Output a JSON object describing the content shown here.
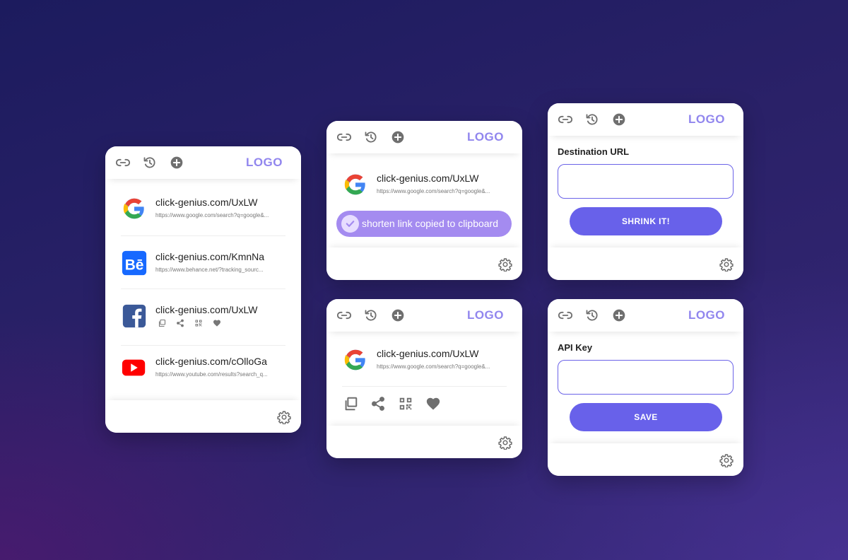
{
  "brand": {
    "logo_text": "LOGO",
    "logo_color": "#9186ee",
    "accent": "#6861ea",
    "icon_gray": "#6f6f6f"
  },
  "history_card": {
    "links": [
      {
        "icon": "google-logo-icon",
        "short": "click-genius.com/UxLW",
        "long": "https://www.google.com/search?q=google&..."
      },
      {
        "icon": "behance-logo-icon",
        "short": "click-genius.com/KmnNa",
        "long": "https://www.behance.net/?tracking_sourc..."
      },
      {
        "icon": "facebook-logo-icon",
        "short": "click-genius.com/UxLW",
        "long": ""
      },
      {
        "icon": "youtube-logo-icon",
        "short": "click-genius.com/cOlloGa",
        "long": "https://www.youtube.com/results?search_q..."
      }
    ]
  },
  "copied_card": {
    "link": {
      "short": "click-genius.com/UxLW",
      "long": "https://www.google.com/search?q=google&..."
    },
    "toast": "shorten link copied to clipboard"
  },
  "actions_card": {
    "link": {
      "short": "click-genius.com/UxLW",
      "long": "https://www.google.com/search?q=google&..."
    },
    "actions": [
      "copy-icon",
      "share-icon",
      "qr-code-icon",
      "heart-icon"
    ]
  },
  "shrink_card": {
    "label": "Destination URL",
    "value": "",
    "placeholder": "",
    "button": "SHRINK IT!"
  },
  "settings_card": {
    "label": "API Key",
    "value": "",
    "placeholder": "",
    "button": "SAVE"
  }
}
